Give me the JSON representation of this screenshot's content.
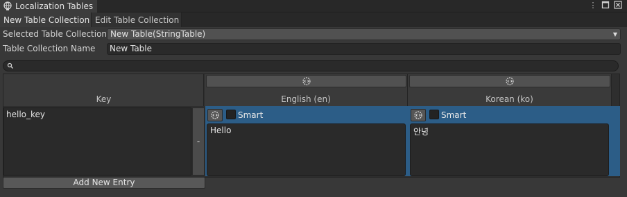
{
  "window": {
    "title": "Localization Tables",
    "controls": [
      "more-icon",
      "maximize-icon",
      "close-icon"
    ]
  },
  "tabs": [
    {
      "label": "New Table Collection",
      "active": true
    },
    {
      "label": "Edit Table Collection",
      "active": false
    }
  ],
  "form": {
    "selected_label": "Selected Table Collection",
    "selected_value": "New Table(StringTable)",
    "name_label": "Table Collection Name",
    "name_value": "New Table"
  },
  "search": {
    "placeholder": ""
  },
  "table": {
    "key_header": "Key",
    "columns": [
      {
        "label": "English (en)"
      },
      {
        "label": "Korean (ko)"
      }
    ],
    "rows": [
      {
        "key": "hello_key",
        "remove_label": "-",
        "cells": [
          {
            "smart_label": "Smart",
            "smart": false,
            "value": "Hello"
          },
          {
            "smart_label": "Smart",
            "smart": false,
            "value": "안녕"
          }
        ]
      }
    ],
    "add_entry_label": "Add New Entry"
  },
  "colors": {
    "background": "#383838",
    "selection": "#2c5d87",
    "field": "#2a2a2a"
  }
}
